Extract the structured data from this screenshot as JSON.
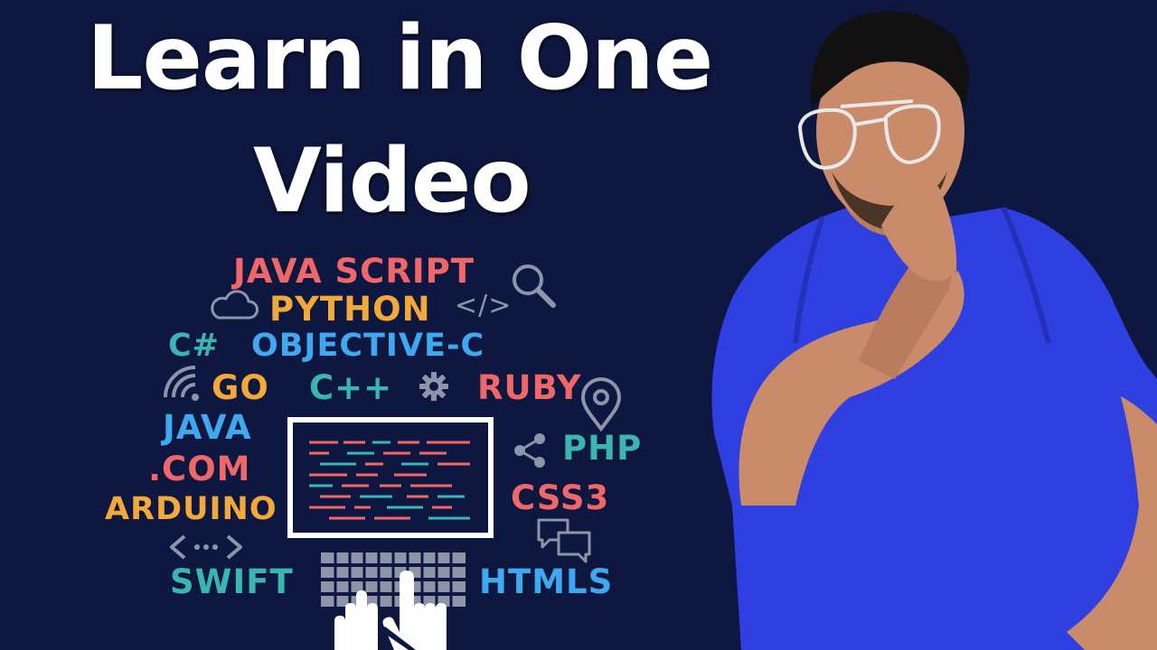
{
  "headline": {
    "line1": "Learn in One",
    "line2": "Video"
  },
  "languages": {
    "javascript": "JAVA SCRIPT",
    "python": "PYTHON",
    "csharp": "C#",
    "objective_c": "OBJECTIVE-C",
    "go": "GO",
    "cpp": "C++",
    "ruby": "RUBY",
    "java": "JAVA",
    "dotcom": ".COM",
    "php": "PHP",
    "arduino": "ARDUINO",
    "css3": "CSS3",
    "swift": "SWIFT",
    "htmls": "HTMLS"
  },
  "code_tag": "</>",
  "colors": {
    "background": "#0e1740",
    "red": "#f0676a",
    "orange": "#f3a83a",
    "teal": "#3ab5b0",
    "blue": "#3fa8ef",
    "gray": "#8f95a8",
    "white": "#ffffff",
    "shirt": "#2f3fe0"
  },
  "icons": [
    "cloud-icon",
    "magnifier-icon",
    "code-tag-icon",
    "wifi-icon",
    "gear-icon",
    "location-pin-icon",
    "share-icon",
    "chat-bubbles-icon",
    "double-arrow-icon",
    "hand-cursor-icon",
    "keyboard-icon",
    "monitor-icon"
  ]
}
